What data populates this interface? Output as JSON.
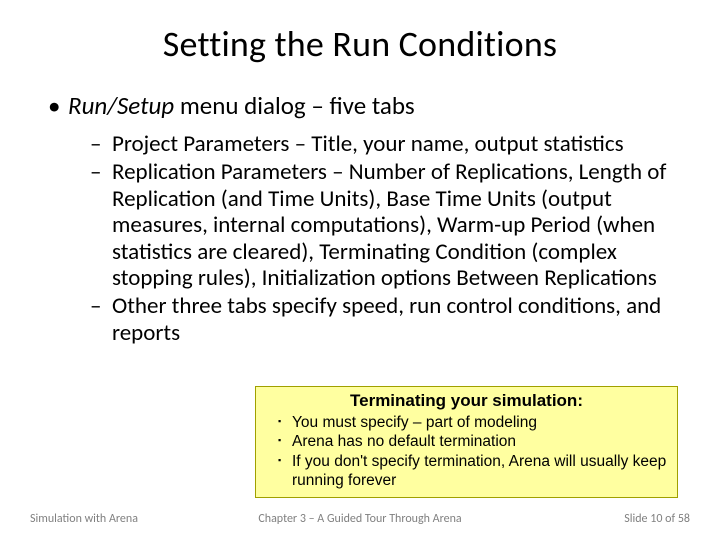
{
  "title": "Setting the Run Conditions",
  "bullet1_italic": "Run/Setup",
  "bullet1_rest": " menu dialog – five tabs",
  "sub1": "Project Parameters – Title, your name, output statistics",
  "sub2": "Replication Parameters – Number of Replications, Length of Replication (and Time Units), Base Time Units (output measures, internal computations), Warm-up Period (when statistics are cleared), Terminating Condition (complex stopping rules), Initialization options Between Replications",
  "sub3": "Other three tabs specify speed, run control conditions, and reports",
  "callout": {
    "title": "Terminating your simulation:",
    "items": [
      "You must specify – part of modeling",
      "Arena has no default termination",
      "If you don't specify termination, Arena will usually keep running forever"
    ]
  },
  "footer": {
    "left": "Simulation with Arena",
    "center": "Chapter 3 – A Guided Tour Through Arena",
    "right": "Slide 10 of 58"
  }
}
